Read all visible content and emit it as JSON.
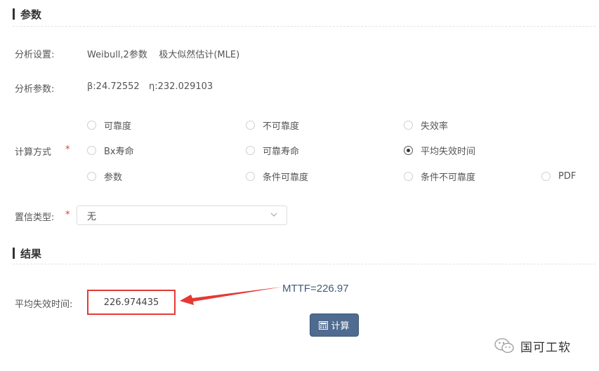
{
  "sections": {
    "params_title": "参数",
    "results_title": "结果"
  },
  "analysis": {
    "settings_label": "分析设置:",
    "settings_value": "Weibull,2参数    极大似然估计(MLE)",
    "params_label": "分析参数:",
    "beta": "β:24.72552",
    "eta": "η:232.029103"
  },
  "calc_method": {
    "label": "计算方式",
    "required_mark": "*",
    "options": [
      {
        "label": "可靠度",
        "checked": false
      },
      {
        "label": "不可靠度",
        "checked": false
      },
      {
        "label": "失效率",
        "checked": false
      },
      {
        "label": "Bx寿命",
        "checked": false
      },
      {
        "label": "可靠寿命",
        "checked": false
      },
      {
        "label": "平均失效时间",
        "checked": true
      },
      {
        "label": "参数",
        "checked": false
      },
      {
        "label": "条件可靠度",
        "checked": false
      },
      {
        "label": "条件不可靠度",
        "checked": false
      },
      {
        "label": "PDF",
        "checked": false
      }
    ]
  },
  "confidence": {
    "label": "置信类型:",
    "required_mark": "*",
    "selected": "无",
    "icon": "chevron-down-icon"
  },
  "result": {
    "label": "平均失效时间:",
    "value": "226.974435",
    "annotation": "MTTF=226.97",
    "highlight_color": "#e53935"
  },
  "calc_button": {
    "label": "计算",
    "icon": "calculator-icon",
    "color": "#4f6b8f"
  },
  "watermark": {
    "text": "国可工软",
    "icon": "wechat-icon"
  }
}
